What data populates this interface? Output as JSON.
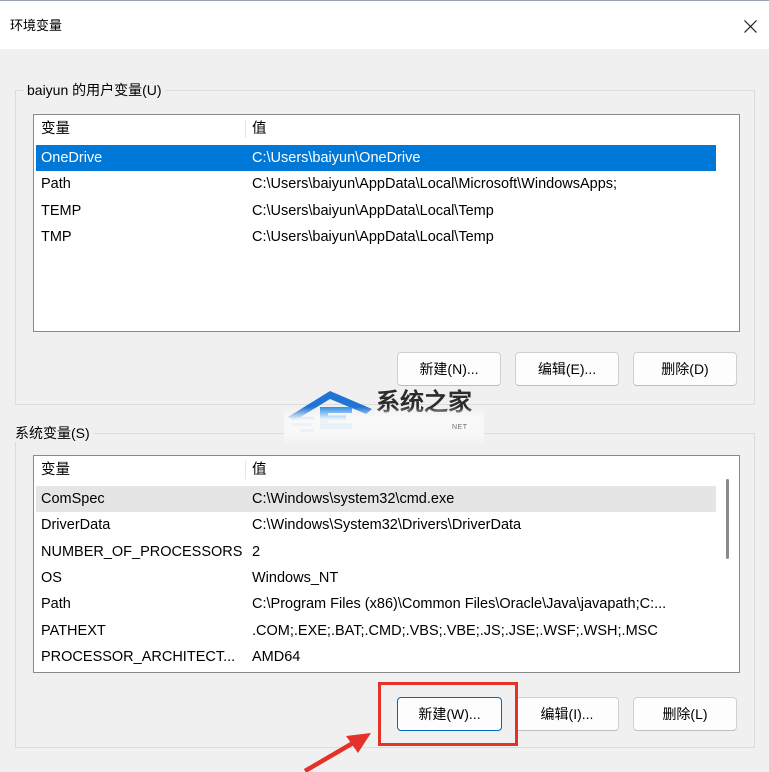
{
  "window": {
    "title": "环境变量"
  },
  "icons": {
    "close": "close-icon",
    "watermark_logo": "watermark-logo-icon"
  },
  "user_vars": {
    "group_label": "baiyun 的用户变量(U)",
    "columns": [
      "变量",
      "值"
    ],
    "rows": [
      {
        "name": "OneDrive",
        "value": "C:\\Users\\baiyun\\OneDrive",
        "selected": true
      },
      {
        "name": "Path",
        "value": "C:\\Users\\baiyun\\AppData\\Local\\Microsoft\\WindowsApps;"
      },
      {
        "name": "TEMP",
        "value": "C:\\Users\\baiyun\\AppData\\Local\\Temp"
      },
      {
        "name": "TMP",
        "value": "C:\\Users\\baiyun\\AppData\\Local\\Temp"
      }
    ],
    "buttons": {
      "new": "新建(N)...",
      "edit": "编辑(E)...",
      "delete": "删除(D)"
    }
  },
  "system_vars": {
    "group_label": "系统变量(S)",
    "columns": [
      "变量",
      "值"
    ],
    "rows": [
      {
        "name": "ComSpec",
        "value": "C:\\Windows\\system32\\cmd.exe",
        "highlighted": true
      },
      {
        "name": "DriverData",
        "value": "C:\\Windows\\System32\\Drivers\\DriverData"
      },
      {
        "name": "NUMBER_OF_PROCESSORS",
        "value": "2"
      },
      {
        "name": "OS",
        "value": "Windows_NT"
      },
      {
        "name": "Path",
        "value": "C:\\Program Files (x86)\\Common Files\\Oracle\\Java\\javapath;C:..."
      },
      {
        "name": "PATHEXT",
        "value": ".COM;.EXE;.BAT;.CMD;.VBS;.VBE;.JS;.JSE;.WSF;.WSH;.MSC"
      },
      {
        "name": "PROCESSOR_ARCHITECT...",
        "value": "AMD64"
      }
    ],
    "buttons": {
      "new": "新建(W)...",
      "edit": "编辑(I)...",
      "delete": "删除(L)",
      "new_focused": true
    }
  },
  "watermark": {
    "text": "系统之家",
    "subtext": "NET"
  },
  "colors": {
    "selection": "#0078d7",
    "inactive_selection": "#e5e5e5",
    "focus_border": "#0067c0",
    "annotation_red": "#e4322b",
    "watermark_blue": "#1f74d6"
  }
}
